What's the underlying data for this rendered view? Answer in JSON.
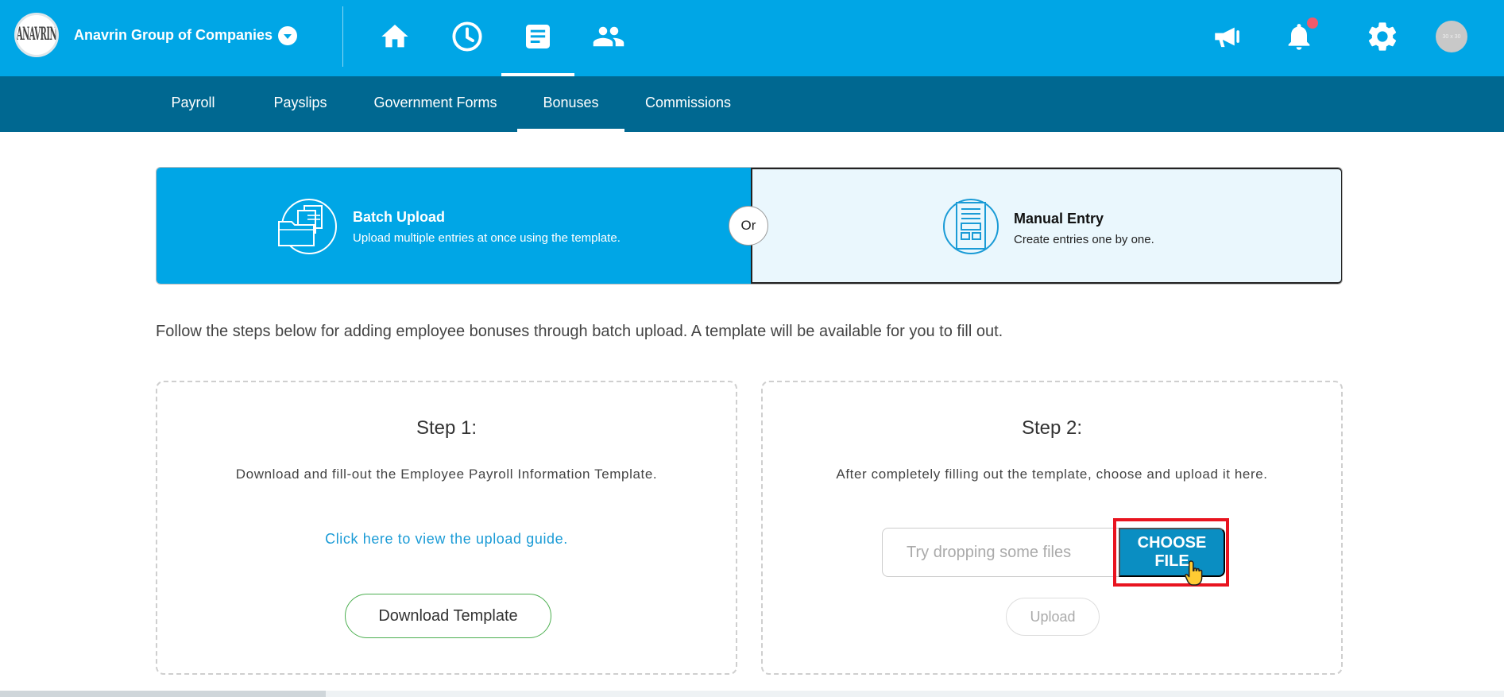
{
  "header": {
    "logo_text": "ANAVRIN",
    "company_name": "Anavrin Group of Companies",
    "nav_icons": [
      "home-icon",
      "clock-icon",
      "document-icon",
      "people-icon"
    ],
    "right_icons": [
      "megaphone-icon",
      "bell-icon",
      "gear-icon"
    ],
    "avatar_text": "30 x 30"
  },
  "subnav": {
    "items": [
      {
        "label": "Payroll"
      },
      {
        "label": "Payslips"
      },
      {
        "label": "Government Forms"
      },
      {
        "label": "Bonuses"
      },
      {
        "label": "Commissions"
      }
    ],
    "active": "Bonuses"
  },
  "modes": {
    "batch": {
      "title": "Batch Upload",
      "desc": "Upload multiple entries at once using the template."
    },
    "or_label": "Or",
    "manual": {
      "title": "Manual Entry",
      "desc": "Create entries one by one."
    }
  },
  "intro": "Follow the steps below for adding employee bonuses through batch upload. A template will be available for you to fill out.",
  "step1": {
    "title": "Step 1:",
    "desc": "Download and fill-out the Employee Payroll Information Template.",
    "link": "Click here to view the upload guide.",
    "button": "Download Template"
  },
  "step2": {
    "title": "Step 2:",
    "desc": "After completely filling out the template, choose and upload it here.",
    "file_placeholder": "Try dropping some files",
    "choose_button": "CHOOSE FILE",
    "upload_button": "Upload"
  },
  "colors": {
    "primary": "#00a6e6",
    "subnav": "#006891",
    "highlight": "#e8141f"
  }
}
